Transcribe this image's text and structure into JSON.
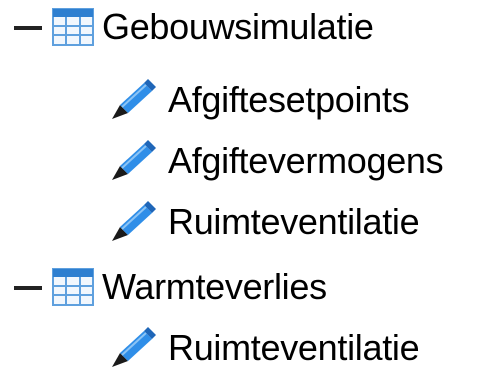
{
  "tree": {
    "groups": [
      {
        "label": "Gebouwsimulatie",
        "icon": "table-icon",
        "expanded": true,
        "children": [
          {
            "label": "Afgiftesetpoints",
            "icon": "pencil-icon"
          },
          {
            "label": "Afgiftevermogens",
            "icon": "pencil-icon"
          },
          {
            "label": "Ruimteventilatie",
            "icon": "pencil-icon"
          }
        ]
      },
      {
        "label": "Warmteverlies",
        "icon": "table-icon",
        "expanded": true,
        "children": [
          {
            "label": "Ruimteventilatie",
            "icon": "pencil-icon"
          }
        ]
      }
    ]
  },
  "colors": {
    "table_header": "#2e7fd0",
    "table_grid": "#5fa0de",
    "table_fill": "#f2f7fd",
    "pencil_body": "#2f8ee8",
    "pencil_dark": "#1f66b8",
    "pencil_tip": "#1a1a1a"
  }
}
